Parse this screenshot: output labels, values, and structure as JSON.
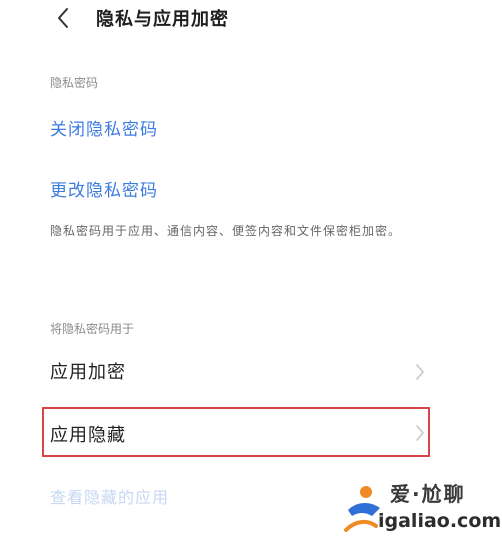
{
  "header": {
    "title": "隐私与应用加密",
    "back_icon": "chevron-left-icon"
  },
  "privacy_password": {
    "section_label": "隐私密码",
    "close_link": "关闭隐私密码",
    "change_link": "更改隐私密码",
    "description": "隐私密码用于应用、通信内容、便签内容和文件保密柜加密。"
  },
  "apply_to": {
    "section_label": "将隐私密码用于",
    "items": [
      {
        "label": "应用加密",
        "icon": "chevron-right-icon"
      },
      {
        "label": "应用隐藏",
        "icon": "chevron-right-icon"
      }
    ],
    "view_hidden_link": "查看隐藏的应用"
  },
  "watermark": {
    "line1": "爱·尬聊",
    "line2": "igaliao.com"
  },
  "colors": {
    "link": "#3d7be0",
    "highlight": "#d9434a",
    "section_label": "#8c8c8c"
  }
}
